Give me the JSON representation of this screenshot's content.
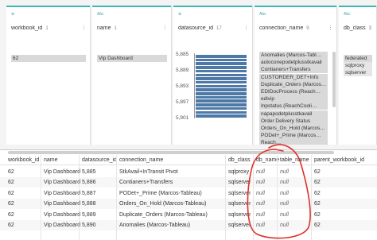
{
  "colors": {
    "accent": "#3fb7b0",
    "histogram": "#4e79a7",
    "annotation": "#e0302a"
  },
  "profile": {
    "cards": [
      {
        "type_icon": "⊕",
        "header": "workbook_id",
        "count": "1",
        "menu_icon": "kebab-menu-icon",
        "values": [
          "62"
        ]
      },
      {
        "type_icon": "Abc",
        "header": "name",
        "count": "1",
        "menu_icon": "kebab-menu-icon",
        "values": [
          "Vip Dashboard"
        ]
      },
      {
        "type_icon": "⊕",
        "header": "datasource_id",
        "count": "17",
        "menu_icon": "kebab-menu-icon",
        "axis_ticks": [
          "5,885",
          "5,889",
          "5,893",
          "5,897",
          "5,901"
        ],
        "histogram_bins": 17
      },
      {
        "type_icon": "Abc",
        "header": "connection_name",
        "count": "9",
        "menu_icon": "kebab-menu-icon",
        "values": [
          "Anomalies (Marcos-Tabl…",
          "autoconepodetplusstkavail",
          "Contianers+Transfers",
          "CUSTORDER_DET+Info",
          "Duplicate_Orders (Marcos…",
          "EDIDocProcess (Reach…",
          "edivip",
          "Inpstatus (ReachCooli…",
          "napapodetplusstkavail",
          "Order Delivery Status",
          "Orders_On_Hold (Marcos…",
          "PODet+_Prime (Marcos…",
          "Reach…"
        ]
      },
      {
        "type_icon": "Abc",
        "header": "db_class",
        "count": "3",
        "menu_icon": "kebab-menu-icon",
        "values": [
          "federated",
          "sqlproxy",
          "sqlserver"
        ]
      }
    ]
  },
  "grid": {
    "columns": [
      "workbook_id",
      "name",
      "datasource_id",
      "connection_name",
      "db_class",
      "db_name",
      "table_name",
      "parent_workbook_id"
    ],
    "rows": [
      [
        "62",
        "Vip Dashboard",
        "5,885",
        "StkAvail+InTransit Pivot",
        "sqlproxy",
        "null",
        "null",
        "62"
      ],
      [
        "62",
        "Vip Dashboard",
        "5,886",
        "Contianers+Transfers",
        "sqlserver",
        "null",
        "null",
        "62"
      ],
      [
        "62",
        "Vip Dashboard",
        "5,887",
        "PODet+_Prime (Marcos-Tableau)",
        "sqlserver",
        "null",
        "null",
        "62"
      ],
      [
        "62",
        "Vip Dashboard",
        "5,888",
        "Orders_On_Hold (Marcos-Tableau)",
        "sqlserver",
        "null",
        "null",
        "62"
      ],
      [
        "62",
        "Vip Dashboard",
        "5,889",
        "Duplicate_Orders (Marcos-Tableau)",
        "sqlserver",
        "null",
        "null",
        "62"
      ],
      [
        "62",
        "Vip Dashboard",
        "5,890",
        "Anomalies (Marcos-Tableau)",
        "sqlserver",
        "null",
        "null",
        "62"
      ]
    ]
  }
}
